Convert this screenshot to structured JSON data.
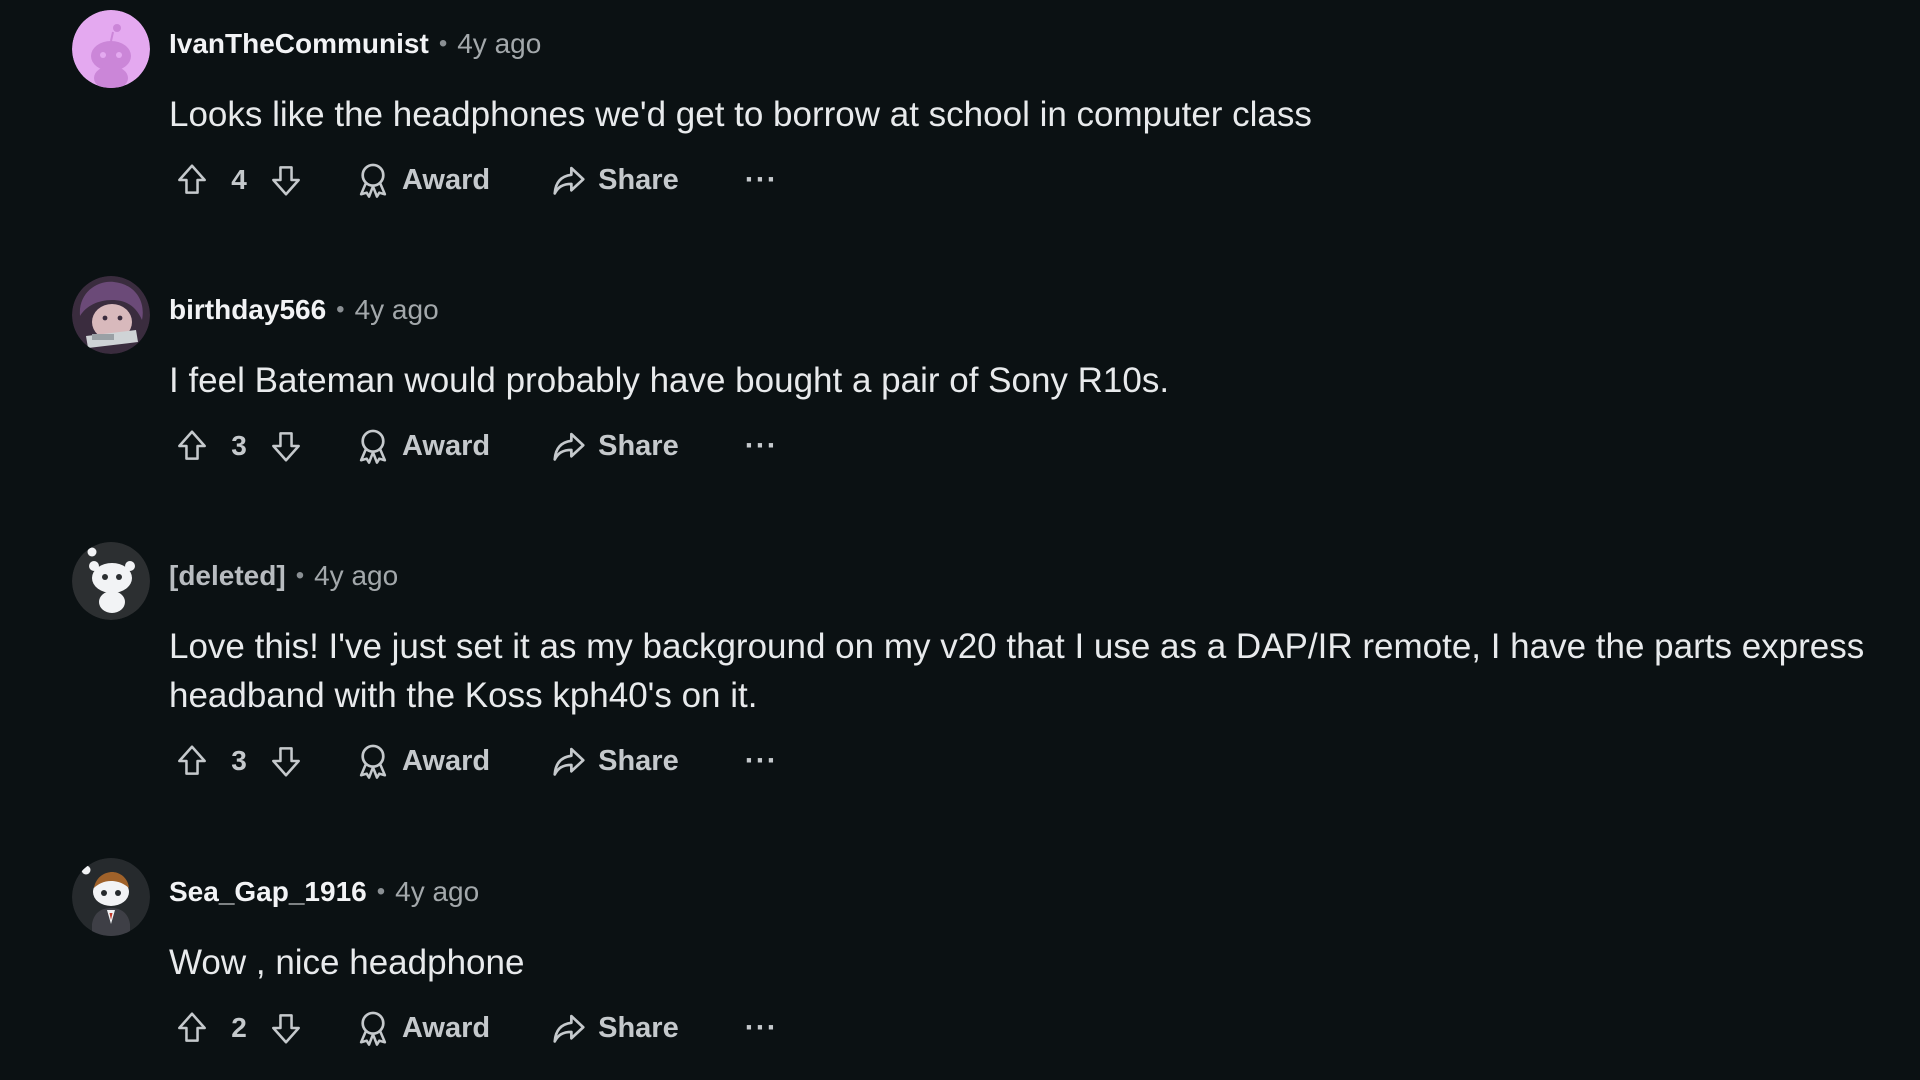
{
  "comments": [
    {
      "username": "IvanTheCommunist",
      "separator": "•",
      "time": "4y ago",
      "text": "Looks like the headphones we'd get to borrow at school in computer class",
      "score": "4",
      "award_label": "Award",
      "share_label": "Share",
      "more_label": "···",
      "avatar": "pink-snoo-avatar"
    },
    {
      "username": "birthday566",
      "separator": "•",
      "time": "4y ago",
      "text": "I feel Bateman would probably have bought a pair of Sony R10s.",
      "score": "3",
      "award_label": "Award",
      "share_label": "Share",
      "more_label": "···",
      "avatar": "anime-character-avatar"
    },
    {
      "username": "[deleted]",
      "separator": "•",
      "time": "4y ago",
      "text": "Love this! I've just set it as my background on my v20 that I use as a DAP/IR remote, I have the parts express headband with the Koss kph40's on it.",
      "score": "3",
      "award_label": "Award",
      "share_label": "Share",
      "more_label": "···",
      "avatar": "deleted-snoo-avatar"
    },
    {
      "username": "Sea_Gap_1916",
      "separator": "•",
      "time": "4y ago",
      "text": "Wow , nice headphone",
      "score": "2",
      "award_label": "Award",
      "share_label": "Share",
      "more_label": "···",
      "avatar": "snoo-suit-avatar"
    }
  ],
  "colors": {
    "background": "#0b1113",
    "username": "#f2f3f5",
    "text": "#e8eaec",
    "muted": "#a3a8ab",
    "avatar_pink": "#e4a9f0"
  },
  "icons": {
    "upvote": "arrow-up-icon",
    "downvote": "arrow-down-icon",
    "award": "award-ribbon-icon",
    "share": "share-arrow-icon",
    "more": "ellipsis-icon"
  }
}
